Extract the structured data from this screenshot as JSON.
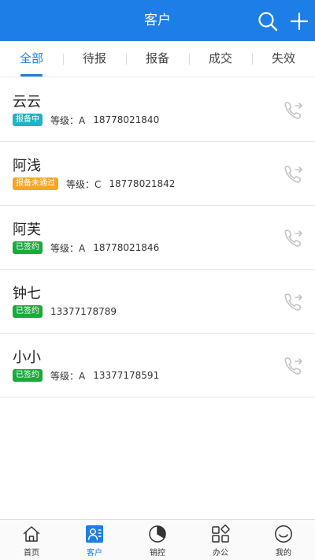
{
  "header": {
    "title": "客户",
    "search_icon": "search-icon",
    "add_icon": "plus-icon"
  },
  "tabs": [
    {
      "label": "全部",
      "active": true
    },
    {
      "label": "待报",
      "active": false
    },
    {
      "label": "报备",
      "active": false
    },
    {
      "label": "成交",
      "active": false
    },
    {
      "label": "失效",
      "active": false
    }
  ],
  "customers": [
    {
      "name": "云云",
      "status": "报备中",
      "status_color": "#1bb6c1",
      "grade": "等级：A",
      "phone": "18778021840"
    },
    {
      "name": "阿浅",
      "status": "报备未通过",
      "status_color": "#f5a623",
      "grade": "等级：C",
      "phone": "18778021842"
    },
    {
      "name": "阿芙",
      "status": "已签约",
      "status_color": "#1aaa3c",
      "grade": "等级：A",
      "phone": "18778021846"
    },
    {
      "name": "钟七",
      "status": "已签约",
      "status_color": "#1aaa3c",
      "grade": "",
      "phone": "13377178789"
    },
    {
      "name": "小小",
      "status": "已签约",
      "status_color": "#1aaa3c",
      "grade": "等级：A",
      "phone": "13377178591"
    }
  ],
  "tabbar": [
    {
      "label": "首页",
      "icon": "home-icon",
      "active": false
    },
    {
      "label": "客户",
      "icon": "customer-icon",
      "active": true
    },
    {
      "label": "销控",
      "icon": "pie-chart-icon",
      "active": false
    },
    {
      "label": "办公",
      "icon": "grid-icon",
      "active": false
    },
    {
      "label": "我的",
      "icon": "smile-icon",
      "active": false
    }
  ],
  "colors": {
    "primary": "#1c7ee6",
    "teal": "#1bb6c1",
    "orange": "#f5a623",
    "green": "#1aaa3c"
  }
}
